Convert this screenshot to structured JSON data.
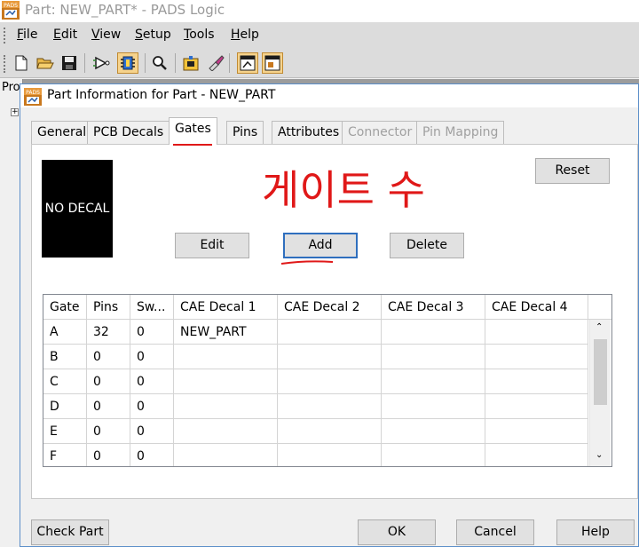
{
  "main_window": {
    "title": "Part: NEW_PART* - PADS Logic"
  },
  "menu": {
    "items": [
      {
        "label": "File",
        "key": "F",
        "rest": "ile"
      },
      {
        "label": "Edit",
        "key": "E",
        "rest": "dit"
      },
      {
        "label": "View",
        "key": "V",
        "rest": "iew"
      },
      {
        "label": "Setup",
        "key": "S",
        "rest": "etup"
      },
      {
        "label": "Tools",
        "key": "T",
        "rest": "ools"
      },
      {
        "label": "Help",
        "key": "H",
        "rest": "elp"
      }
    ]
  },
  "toolbar": {
    "buttons": [
      "new-document-icon",
      "open-folder-icon",
      "save-disk-icon",
      "gate-icon",
      "part-editor-icon",
      "zoom-icon",
      "decal-editor-icon",
      "eraser-brush-icon",
      "window-icon-1",
      "window-icon-2"
    ]
  },
  "project_panel": {
    "label": "Pro"
  },
  "dialog": {
    "title": "Part Information for Part - NEW_PART",
    "tabs": [
      {
        "label": "General",
        "state": "normal"
      },
      {
        "label": "PCB Decals",
        "state": "normal"
      },
      {
        "label": "Gates",
        "state": "active"
      },
      {
        "label": "Pins",
        "state": "normal"
      },
      {
        "label": "Attributes",
        "state": "normal"
      },
      {
        "label": "Connector",
        "state": "disabled"
      },
      {
        "label": "Pin Mapping",
        "state": "disabled"
      }
    ],
    "decal_preview": "NO DECAL",
    "buttons": {
      "reset": "Reset",
      "edit": "Edit",
      "add": "Add",
      "delete": "Delete"
    },
    "annotation": "게이트 수",
    "grid": {
      "columns": [
        "Gate",
        "Pins",
        "Sw...",
        "CAE Decal 1",
        "CAE Decal 2",
        "CAE Decal 3",
        "CAE Decal 4"
      ],
      "rows": [
        [
          "A",
          "32",
          "0",
          "NEW_PART",
          "",
          "",
          ""
        ],
        [
          "B",
          "0",
          "0",
          "",
          "",
          "",
          ""
        ],
        [
          "C",
          "0",
          "0",
          "",
          "",
          "",
          ""
        ],
        [
          "D",
          "0",
          "0",
          "",
          "",
          "",
          ""
        ],
        [
          "E",
          "0",
          "0",
          "",
          "",
          "",
          ""
        ],
        [
          "F",
          "0",
          "0",
          "",
          "",
          "",
          ""
        ]
      ]
    },
    "footer": {
      "check_part": "Check Part",
      "ok": "OK",
      "cancel": "Cancel",
      "help": "Help"
    }
  },
  "colors": {
    "annotation_red": "#e01818",
    "accent_blue": "#2f6fbe"
  }
}
